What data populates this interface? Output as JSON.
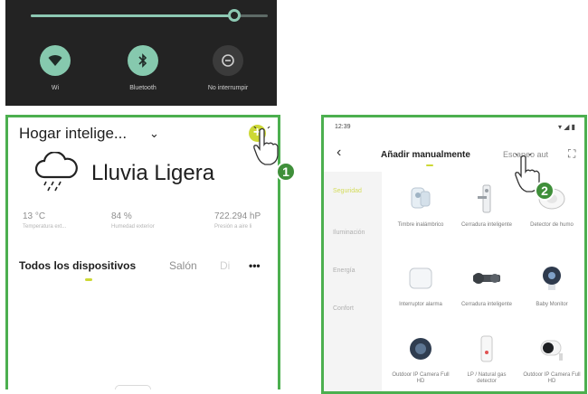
{
  "quick_settings": {
    "brightness_level": 0.86,
    "tiles": [
      {
        "label": "Wi",
        "icon": "wifi-icon",
        "active": true
      },
      {
        "label": "Bluetooth",
        "icon": "bluetooth-icon",
        "active": true
      },
      {
        "label": "No interrumpir",
        "icon": "do-not-disturb-icon",
        "active": false
      }
    ]
  },
  "home": {
    "title": "Hogar intelige...",
    "weather": "Lluvia Ligera",
    "stats": [
      {
        "value": "13 °C",
        "label": "Temperatura ext..."
      },
      {
        "value": "84 %",
        "label": "Humedad exterior"
      },
      {
        "value": "722.294 hP",
        "label": "Presión a aire li"
      }
    ],
    "tabs": [
      "Todos los dispositivos",
      "Salón",
      "Di",
      "•••"
    ]
  },
  "add_device": {
    "time": "12:39",
    "status_icons": "▾ ◢ ▮",
    "title": "Añadir manualmente",
    "scan_label": "Escaneo aut",
    "sidebar": [
      "Seguridad",
      "Iluminación",
      "Energía",
      "Confort"
    ],
    "devices": [
      {
        "name": "Timbre inalámbrico",
        "icon": "doorbell-icon"
      },
      {
        "name": "Cerradura inteligente",
        "icon": "smart-lock-icon"
      },
      {
        "name": "Detector de humo",
        "icon": "smoke-detector-icon"
      },
      {
        "name": "Interruptor alarma",
        "icon": "alarm-hub-icon"
      },
      {
        "name": "Cerradura inteligente",
        "icon": "door-lock-icon"
      },
      {
        "name": "Baby Monitor",
        "icon": "baby-monitor-icon"
      },
      {
        "name": "Outdoor IP Camera Full HD",
        "icon": "outdoor-camera-icon"
      },
      {
        "name": "LP / Natural gas detector",
        "icon": "gas-detector-icon"
      },
      {
        "name": "Outdoor IP Camera Full HD",
        "icon": "ip-camera-icon"
      }
    ]
  },
  "steps": [
    "1",
    "2"
  ],
  "colors": {
    "frame": "#4caf4f",
    "accent": "#cdd836",
    "badge": "#3f8f3a",
    "qs_on": "#86c9ae"
  }
}
